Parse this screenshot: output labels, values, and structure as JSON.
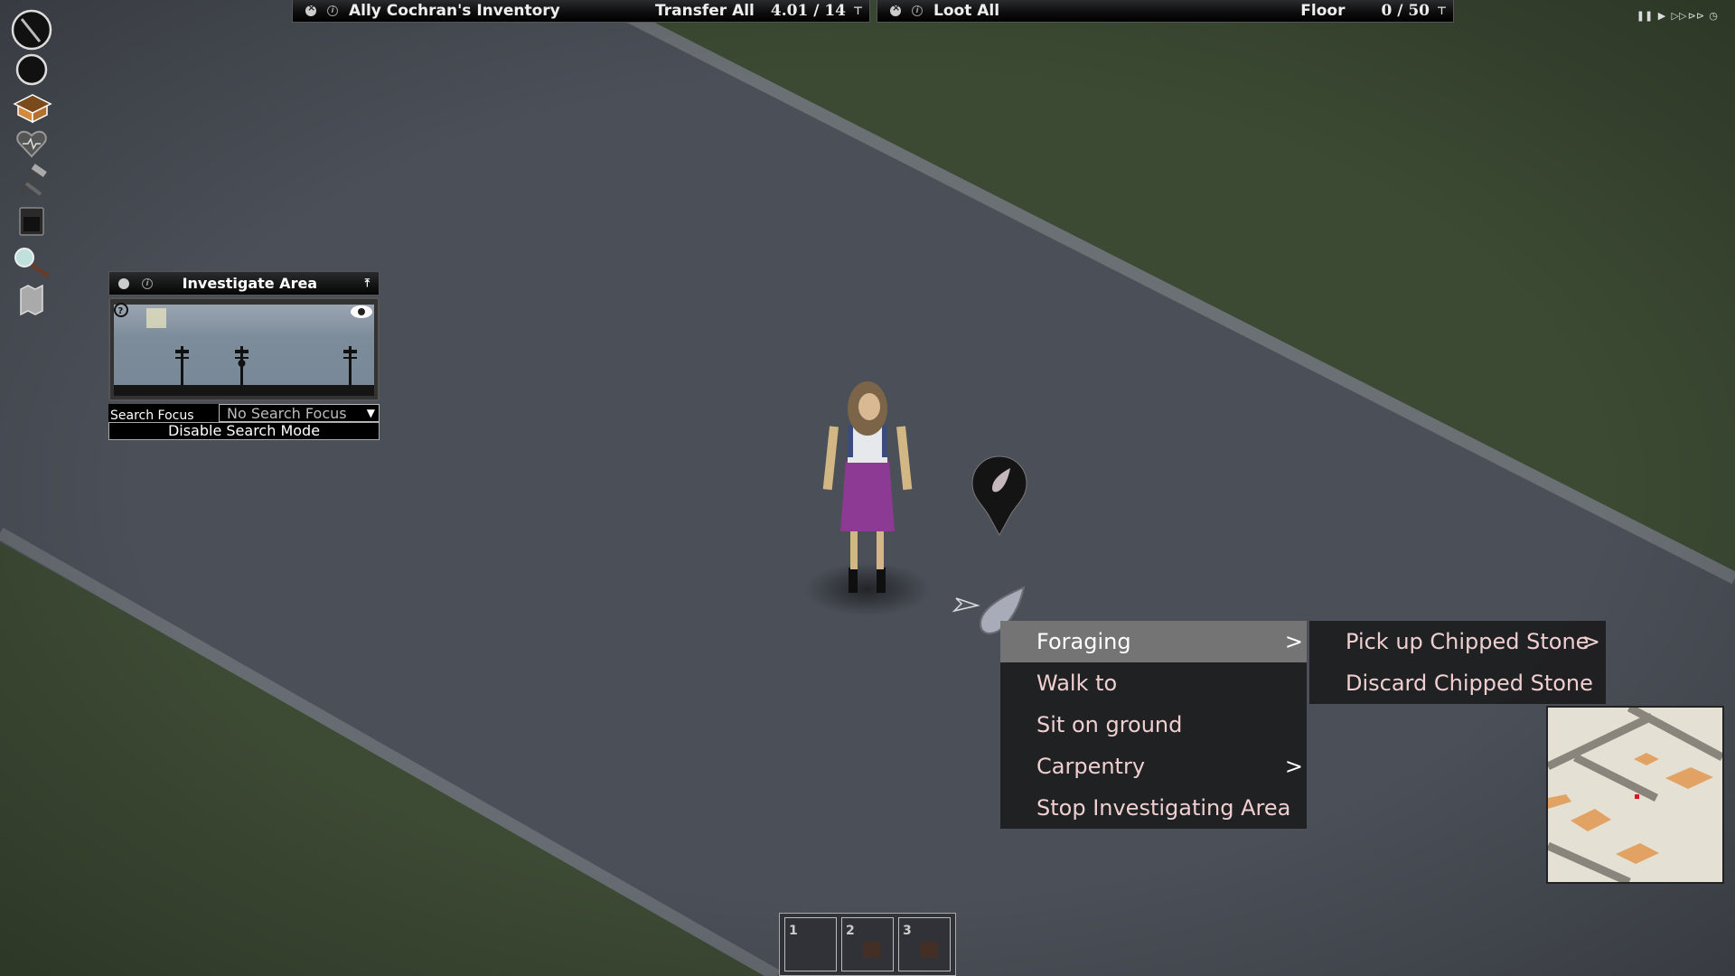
{
  "inventory_bar": {
    "title": "Ally Cochran's Inventory",
    "transfer_all": "Transfer All",
    "weight": "4.01 / 14"
  },
  "loot_bar": {
    "loot_all": "Loot All",
    "container": "Floor",
    "weight": "0 / 50"
  },
  "speed_controls": [
    "pause",
    "play",
    "fast-forward",
    "fastest",
    "clock"
  ],
  "sidebar": {
    "icons": [
      "primary-weapon-slot",
      "secondary-slot",
      "inventory-box",
      "health-heart",
      "crafting-tools",
      "furniture-stove",
      "search-magnifier",
      "map"
    ]
  },
  "investigate_panel": {
    "title": "Investigate Area",
    "search_focus_label": "Search Focus",
    "search_focus_value": "No Search Focus",
    "disable_button": "Disable Search Mode"
  },
  "context_menu": {
    "items": [
      {
        "label": "Foraging",
        "submenu": true,
        "active": true
      },
      {
        "label": "Walk to",
        "submenu": false
      },
      {
        "label": "Sit on ground",
        "submenu": false
      },
      {
        "label": "Carpentry",
        "submenu": true
      },
      {
        "label": "Stop Investigating Area",
        "submenu": false
      }
    ],
    "arrow": ">"
  },
  "submenu": {
    "items": [
      {
        "label": "Pick up Chipped Stone",
        "submenu": true
      },
      {
        "label": "Discard Chipped Stone",
        "submenu": false
      }
    ],
    "arrow": ">"
  },
  "hotbar": {
    "slots": [
      {
        "number": "1",
        "item": ""
      },
      {
        "number": "2",
        "item": "bag"
      },
      {
        "number": "3",
        "item": "bag"
      }
    ]
  },
  "colors": {
    "menu_text": "#efcfd0",
    "menu_active_bg": "#747474",
    "road": "#4b5058",
    "grass": "#3d4a34",
    "minimap_building": "#e1a264",
    "player_marker": "#e0141e"
  }
}
